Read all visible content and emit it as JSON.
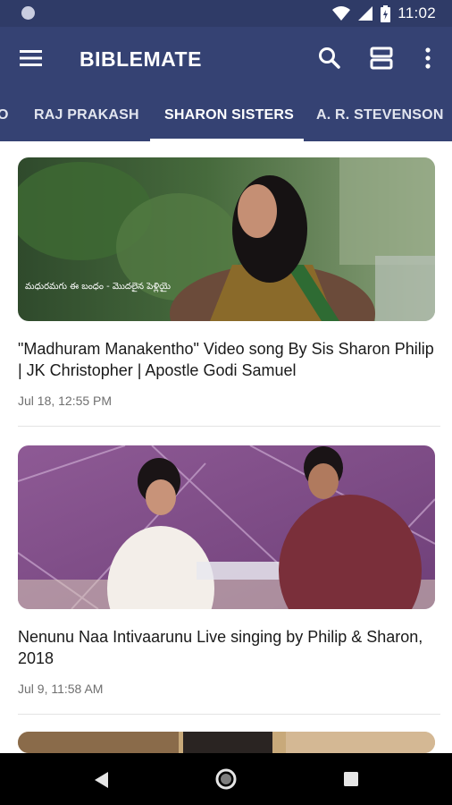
{
  "status_bar": {
    "time": "11:02",
    "icons": [
      "wifi-icon",
      "signal-icon",
      "battery-icon"
    ]
  },
  "app_bar": {
    "title": "BIBLEMATE",
    "actions": [
      "search-icon",
      "view-toggle-icon",
      "more-vert-icon"
    ]
  },
  "tabs": [
    {
      "label": "O"
    },
    {
      "label": "RAJ PRAKASH"
    },
    {
      "label": "SHARON SISTERS",
      "selected": true
    },
    {
      "label": "A. R. STEVENSON"
    }
  ],
  "feed": [
    {
      "title": "\"Madhuram Manakentho\" Video song By Sis Sharon Philip | JK Christopher | Apostle Godi Samuel",
      "date": "Jul 18, 12:55 PM",
      "overlay_text": "మధురమగు ఈ బంధం - మొదలైన పెళ్లియై"
    },
    {
      "title": "Nenunu Naa Intivaarunu Live singing by Philip & Sharon, 2018",
      "date": "Jul 9, 11:58 AM"
    }
  ],
  "colors": {
    "primary": "#354273",
    "status": "#2f3b67",
    "indicator": "#ffffff"
  }
}
